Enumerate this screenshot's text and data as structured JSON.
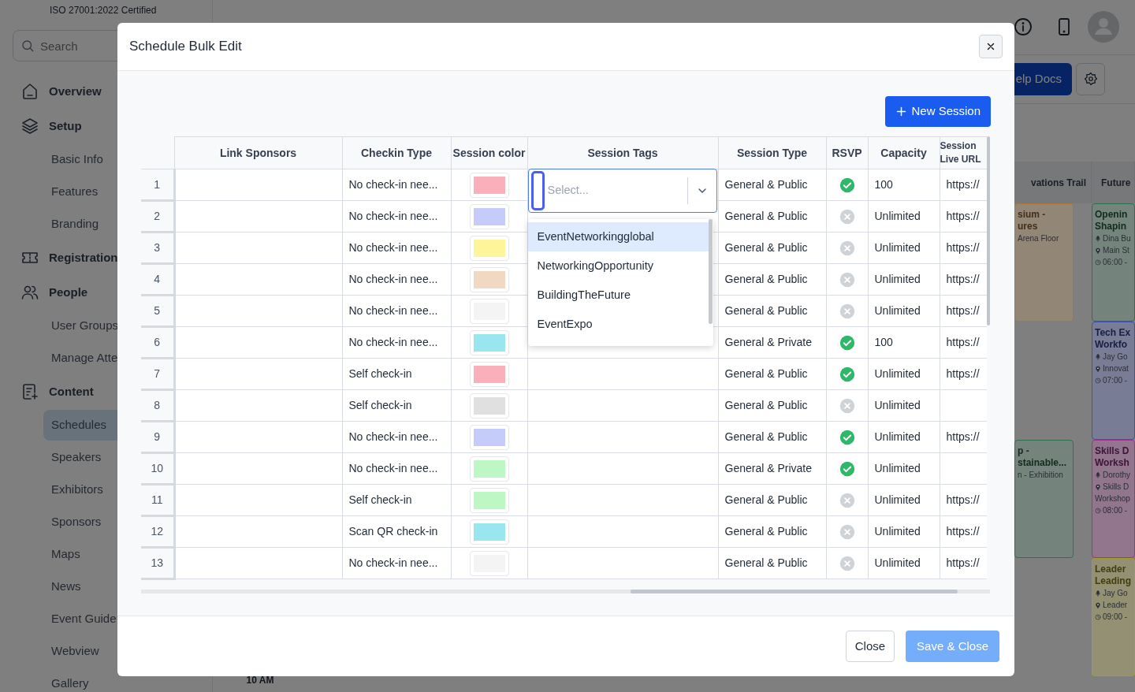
{
  "sidebar": {
    "certification": "ISO 27001:2022 Certified",
    "search": {
      "placeholder": "Search"
    },
    "items": [
      {
        "label": "Overview",
        "selected": false
      },
      {
        "label": "Setup",
        "selected": false,
        "children": [
          {
            "label": "Basic Info",
            "selected": false
          },
          {
            "label": "Features",
            "selected": false
          },
          {
            "label": "Branding",
            "selected": false
          }
        ]
      },
      {
        "label": "Registration",
        "selected": false
      },
      {
        "label": "People",
        "selected": false,
        "children": [
          {
            "label": "User Groups",
            "selected": false
          },
          {
            "label": "Manage Atte",
            "selected": false
          }
        ]
      },
      {
        "label": "Content",
        "selected": false,
        "children": [
          {
            "label": "Schedules",
            "selected": true
          },
          {
            "label": "Speakers",
            "selected": false
          },
          {
            "label": "Exhibitors",
            "selected": false
          },
          {
            "label": "Sponsors",
            "selected": false
          },
          {
            "label": "Maps",
            "selected": false
          },
          {
            "label": "News",
            "selected": false
          },
          {
            "label": "Event Guide",
            "selected": false
          },
          {
            "label": "Webview",
            "selected": false
          },
          {
            "label": "Gallery",
            "selected": false
          }
        ]
      }
    ]
  },
  "toolbar": {
    "help_button": "elp Docs"
  },
  "calendar": {
    "time_label": "10 AM",
    "tracks": [
      {
        "header": "vations Trail",
        "sessions": [
          {
            "kind": "session",
            "color": "#a8753a",
            "title": [
              "sium -",
              "ures"
            ],
            "details": [
              {
                "kind": "plain",
                "text": "Arena Floor"
              }
            ]
          },
          {
            "kind": "empty"
          },
          {
            "kind": "session",
            "color": "#2f6e4e",
            "title": [
              "p -",
              "stainable..."
            ],
            "details": [
              {
                "kind": "plain",
                "text": "n - Exhibition"
              }
            ]
          }
        ]
      },
      {
        "header": "Future",
        "sessions": [
          {
            "kind": "session",
            "color": "#2f6e4e",
            "title": [
              "Openin",
              "Shapin"
            ],
            "details": [
              {
                "kind": "speaker",
                "text": "Dina Bu"
              },
              {
                "kind": "venue",
                "text": "Main St"
              },
              {
                "kind": "time",
                "text": "06:00 -"
              }
            ]
          },
          {
            "kind": "session",
            "color": "#3d4fb0",
            "title": [
              "Tech Ex",
              "Workfo"
            ],
            "details": [
              {
                "kind": "speaker",
                "text": "Jay Go"
              },
              {
                "kind": "venue",
                "text": "Innovat"
              },
              {
                "kind": "time",
                "text": "07:00 -"
              }
            ]
          },
          {
            "kind": "session",
            "color": "#a0338f",
            "title": [
              "Skills D",
              "Worksh"
            ],
            "details": [
              {
                "kind": "speaker",
                "text": "Dorothy"
              },
              {
                "kind": "venue",
                "text": "Skills D"
              },
              {
                "kind": "plain",
                "text": "Workshop"
              },
              {
                "kind": "time",
                "text": "08:00 -"
              }
            ]
          },
          {
            "kind": "session",
            "color": "#a89b2a",
            "title": [
              "Leader",
              "Leading"
            ],
            "details": [
              {
                "kind": "speaker",
                "text": "Jay Go"
              },
              {
                "kind": "venue",
                "text": "Leader"
              },
              {
                "kind": "time",
                "text": "09:00 -"
              }
            ]
          }
        ]
      }
    ]
  },
  "modal": {
    "title": "Schedule Bulk Edit",
    "new_button": "New Session",
    "columns": [
      "Link Sponsors",
      "Checkin Type",
      "Session color",
      "Session Tags",
      "Session Type",
      "RSVP",
      "Capacity",
      "Session Live URL"
    ],
    "rows": [
      {
        "number": "1",
        "checkin": "No check-in nee...",
        "color": "#f9b0bb",
        "tags": {
          "placeholder": "Select...",
          "open": true,
          "options": [
            {
              "label": "EventNetworkingglobal",
              "highlighted": true
            },
            {
              "label": "NetworkingOpportunity",
              "highlighted": false
            },
            {
              "label": "BuildingTheFuture",
              "highlighted": false
            },
            {
              "label": "EventExpo",
              "highlighted": false
            }
          ]
        },
        "type": "General & Public",
        "rsvp": true,
        "capacity": "100",
        "url": "https://"
      },
      {
        "number": "2",
        "checkin": "No check-in nee...",
        "color": "#c6ccf9",
        "type": "General & Public",
        "rsvp": false,
        "capacity": "Unlimited",
        "url": "https://"
      },
      {
        "number": "3",
        "checkin": "No check-in nee...",
        "color": "#fef59a",
        "type": "General & Public",
        "rsvp": false,
        "capacity": "Unlimited",
        "url": "https://"
      },
      {
        "number": "4",
        "checkin": "No check-in nee...",
        "color": "#f0d9c0",
        "type": "General & Public",
        "rsvp": false,
        "capacity": "Unlimited",
        "url": "https://"
      },
      {
        "number": "5",
        "checkin": "No check-in nee...",
        "color": "#f4f4f4",
        "type": "General & Public",
        "rsvp": false,
        "capacity": "Unlimited",
        "url": "https://"
      },
      {
        "number": "6",
        "checkin": "No check-in nee...",
        "color": "#99e6ef",
        "type": "General & Private",
        "rsvp": true,
        "capacity": "100",
        "url": "https://"
      },
      {
        "number": "7",
        "checkin": "Self check-in",
        "color": "#f9b0bb",
        "type": "General & Public",
        "rsvp": true,
        "capacity": "Unlimited",
        "url": "https://"
      },
      {
        "number": "8",
        "checkin": "Self check-in",
        "color": "#e0e0e0",
        "type": "General & Public",
        "rsvp": false,
        "capacity": "Unlimited"
      },
      {
        "number": "9",
        "checkin": "No check-in nee...",
        "color": "#c6ccf9",
        "type": "General & Public",
        "rsvp": true,
        "capacity": "Unlimited",
        "url": "https://"
      },
      {
        "number": "10",
        "checkin": "No check-in nee...",
        "color": "#bdf7c4",
        "type": "General & Private",
        "rsvp": true,
        "capacity": "Unlimited"
      },
      {
        "number": "11",
        "checkin": "Self check-in",
        "color": "#bdf7c4",
        "type": "General & Public",
        "rsvp": false,
        "capacity": "Unlimited",
        "url": "https://"
      },
      {
        "number": "12",
        "checkin": "Scan QR check-in",
        "color": "#99e6ef",
        "type": "General & Public",
        "rsvp": false,
        "capacity": "Unlimited",
        "url": "https://"
      },
      {
        "number": "13",
        "checkin": "No check-in nee...",
        "color": "#f4f4f4",
        "type": "General & Public",
        "rsvp": false,
        "capacity": "Unlimited",
        "url": "https://"
      }
    ],
    "footer": {
      "close": "Close",
      "save": {
        "label": "Save & Close",
        "disabled": true
      }
    }
  }
}
